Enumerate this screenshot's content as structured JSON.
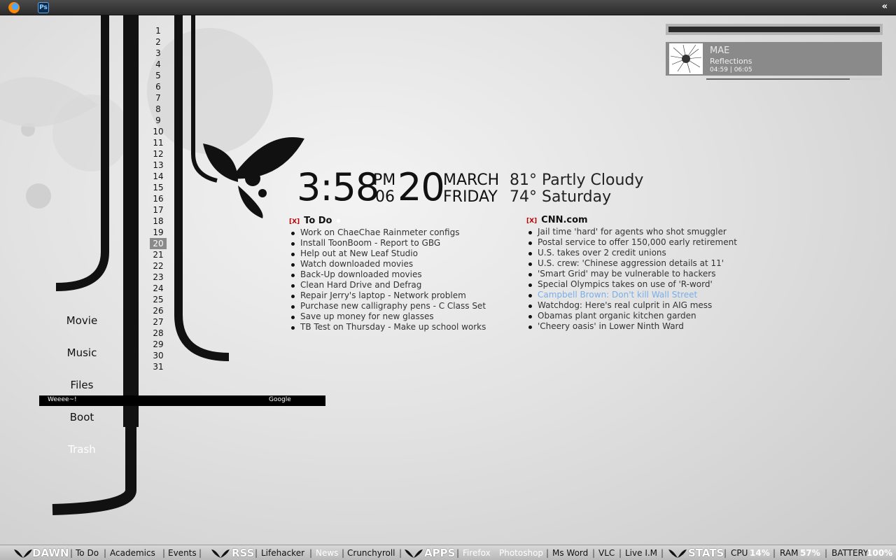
{
  "topbar": {
    "apps": [
      "firefox-icon",
      "photoshop-icon"
    ],
    "ps_label": "Ps",
    "collapse_label": "«"
  },
  "calendar": {
    "days": [
      "1",
      "2",
      "3",
      "4",
      "5",
      "6",
      "7",
      "8",
      "9",
      "10",
      "11",
      "12",
      "13",
      "14",
      "15",
      "16",
      "17",
      "18",
      "19",
      "20",
      "21",
      "22",
      "23",
      "24",
      "25",
      "26",
      "27",
      "28",
      "29",
      "30",
      "31"
    ],
    "today": "20"
  },
  "launcher": {
    "movie": "Movie",
    "music": "Music",
    "files": "Files",
    "boot": "Boot",
    "trash": "Trash"
  },
  "search": {
    "query": "Weeee~!",
    "engine": "Google"
  },
  "clock": {
    "time": "3:58",
    "ampm": "PM",
    "seconds": "06",
    "day": "20",
    "month": "MARCH",
    "weekday": "FRIDAY"
  },
  "weather": {
    "today_temp": "81°",
    "today_cond": "Partly Cloudy",
    "tomorrow_temp": "74°",
    "tomorrow_day": "Saturday"
  },
  "todo": {
    "close": "[X]",
    "title": "To Do",
    "items": [
      "Work on ChaeChae Rainmeter configs",
      "Install ToonBoom - Report to GBG",
      "Help out at New Leaf Studio",
      "Watch downloaded movies",
      "Back-Up downloaded movies",
      "Clean Hard Drive and Defrag",
      "Repair Jerry's laptop - Network problem",
      "Purchase new calligraphy pens - C Class Set",
      "Save up money for new glasses",
      "TB Test on Thursday - Make up school works"
    ]
  },
  "news": {
    "close": "[X]",
    "title": "CNN.com",
    "items": [
      "Jail time 'hard' for agents who shot smuggler",
      "Postal service to offer 150,000 early retirement",
      "U.S. takes over 2 credit unions",
      "U.S. crew: 'Chinese aggression  details at 11'",
      "'Smart Grid' may be vulnerable to hackers",
      "Special Olympics takes on use of 'R-word'",
      "Campbell Brown: Don't kill Wall Street",
      "Watchdog: Here's real culprit in AIG mess",
      "Obamas plant organic kitchen garden",
      "'Cheery oasis' in Lower Ninth Ward"
    ],
    "highlighted_index": 6
  },
  "music": {
    "artist": "MAE",
    "track": "Reflections",
    "time": "04:59 | 06:05",
    "progress": 0.82
  },
  "bottombar": {
    "dawn": "DAWN",
    "todo": "To Do",
    "academics": "Academics",
    "events": "Events",
    "rss": "RSS",
    "lifehacker": "Lifehacker",
    "news": "News",
    "crunchyroll": "Crunchyroll",
    "apps": "APPS",
    "firefox": "Firefox",
    "photoshop": "Photoshop",
    "msword": "Ms Word",
    "vlc": "VLC",
    "liveim": "Live I.M",
    "stats": "STATS",
    "cpu_label": "CPU",
    "cpu_val": "14%",
    "ram_label": "RAM",
    "ram_val": "57%",
    "battery_label": "BATTERY",
    "battery_val": "100%",
    "sep": "|"
  }
}
